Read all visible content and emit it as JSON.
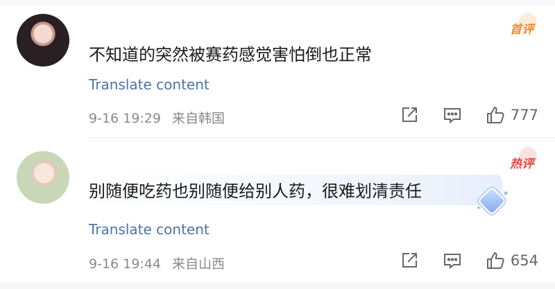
{
  "comments": [
    {
      "badge": "首评",
      "text": "不知道的突然被赛药感觉害怕倒也正常",
      "translate_label": "Translate content",
      "date": "9-16 19:29",
      "location": "来自韩国",
      "likes": "777",
      "avatar_icon": "avatar-photo-woman"
    },
    {
      "badge": "热评",
      "text": "别随便吃药也别随便给别人药，很难划清责任",
      "translate_label": "Translate content",
      "date": "9-16 19:44",
      "location": "来自山西",
      "likes": "654",
      "avatar_icon": "avatar-photo-woman"
    }
  ],
  "colors": {
    "link": "#4b74a6",
    "meta": "#8a8a8a",
    "first_badge": "#f08a2b",
    "hot_badge": "#e8443a"
  },
  "icons": [
    "share-icon",
    "reply-icon",
    "like-icon"
  ]
}
